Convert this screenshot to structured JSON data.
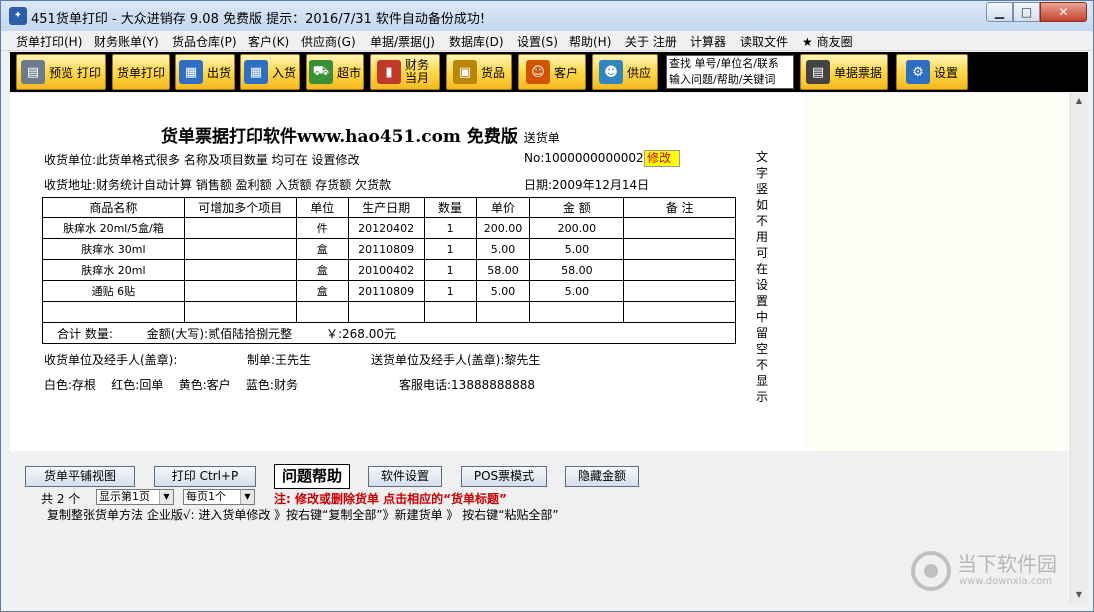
{
  "window": {
    "title": "451货单打印 - 大众进销存 9.08 免费版  提示：2016/7/31 软件自动备份成功!",
    "min": "▁",
    "max": "□",
    "close": "✕"
  },
  "menu": [
    "货单打印(H)",
    "财务账单(Y)",
    "货品仓库(P)",
    "客户(K)",
    "供应商(G)",
    "单据/票据(J)",
    "数据库(D)",
    "设置(S)",
    "帮助(H)",
    "关于 注册",
    "计算器",
    "读取文件",
    "★ 商友圈"
  ],
  "toolbar": {
    "preview": "预览 打印",
    "print_order": "货单打印",
    "out": "出货",
    "in": "入货",
    "market": "超市",
    "finance": "财务当月",
    "goods": "货品",
    "customer": "客户",
    "supplier": "供应",
    "search_line1": "查找 单号/单位名/联系",
    "search_line2": "输入问题/帮助/关键词",
    "bills": "单据票据",
    "settings": "设置"
  },
  "doc": {
    "title": "货单票据打印软件www.hao451.com 免费版",
    "subtitle": "送货单",
    "recv_unit": "收货单位:此货单格式很多 名称及项目数量 均可在 设置修改",
    "order_no": "No:1000000000002",
    "edit": "修改",
    "recv_addr": "收货地址:财务统计自动计算 销售额 盈利额 入货额 存货额 欠货款",
    "date": "日期:2009年12月14日",
    "headers": [
      "商品名称",
      "可增加多个项目",
      "单位",
      "生产日期",
      "数量",
      "单价",
      "金 额",
      "备 注"
    ],
    "rows": [
      [
        "肤痒水 20ml/5盒/箱",
        "",
        "件",
        "20120402",
        "1",
        "200.00",
        "200.00",
        ""
      ],
      [
        "肤痒水 30ml",
        "",
        "盒",
        "20110809",
        "1",
        "5.00",
        "5.00",
        ""
      ],
      [
        "肤痒水 20ml",
        "",
        "盒",
        "20100402",
        "1",
        "58.00",
        "58.00",
        ""
      ],
      [
        "通贴 6贴",
        "",
        "盒",
        "20110809",
        "1",
        "5.00",
        "5.00",
        ""
      ],
      [
        "",
        "",
        "",
        "",
        "",
        "",
        "",
        ""
      ]
    ],
    "sum_label": "合计  数量:",
    "sum_amount_big": "金额(大写):贰佰陆拾捌元整",
    "sum_amount": "￥:268.00元",
    "recv_sign": "收货单位及经手人(盖章):",
    "maker": "制单:王先生",
    "send_sign": "送货单位及经手人(盖章):黎先生",
    "copies": "白色:存根    红色:回单    黄色:客户    蓝色:财务",
    "service": "客服电话:13888888888",
    "vertical": "文字 竖 如不用可在设置中留空不显示"
  },
  "bottom": {
    "flat_view": "货单平铺视图",
    "print": "打印 Ctrl+P",
    "help": "问题帮助",
    "soft_settings": "软件设置",
    "pos": "POS票模式",
    "hide_amount": "隐藏金额",
    "total": "共 2 个",
    "show_page": "显示第1页",
    "per_page": "每页1个",
    "note": "注: 修改或删除货单  点击相应的“货单标题”",
    "copy_tip": "复制整张货单方法 企业版√: 进入货单修改 》按右键“复制全部”》新建货单 》 按右键“粘贴全部”"
  },
  "watermark": {
    "brand": "当下软件园",
    "url": "www.downxia.com"
  }
}
